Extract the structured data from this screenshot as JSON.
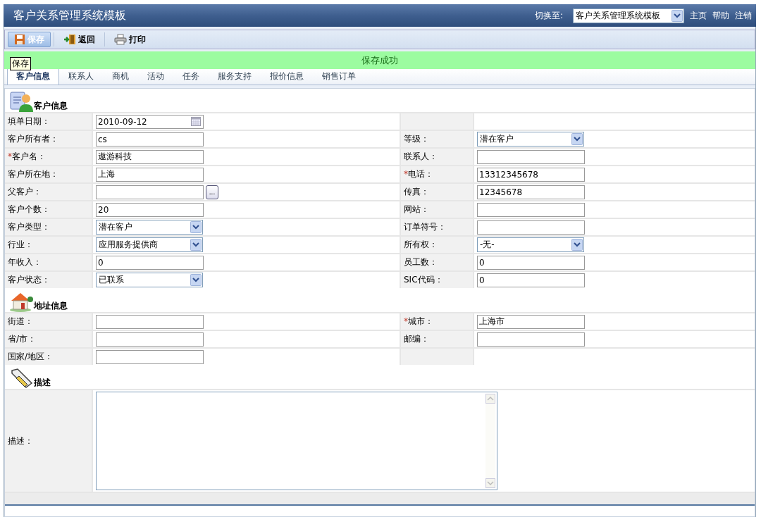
{
  "header": {
    "title": "客户关系管理系统模板",
    "switch_label": "切换至:",
    "switch_value": "客户关系管理系统模板",
    "links": [
      "主页",
      "帮助",
      "注销"
    ]
  },
  "toolbar": [
    {
      "kind": "save",
      "label": "保存",
      "highlighted": true
    },
    {
      "kind": "back",
      "label": "返回",
      "highlighted": false
    },
    {
      "kind": "print",
      "label": "打印",
      "highlighted": false
    }
  ],
  "tooltip": "保存",
  "status_message": "保存成功",
  "tabs": [
    {
      "label": "客户信息",
      "selected": true
    },
    {
      "label": "联系人",
      "selected": false
    },
    {
      "label": "商机",
      "selected": false
    },
    {
      "label": "活动",
      "selected": false
    },
    {
      "label": "任务",
      "selected": false
    },
    {
      "label": "服务支持",
      "selected": false
    },
    {
      "label": "报价信息",
      "selected": false
    },
    {
      "label": "销售订单",
      "selected": false
    }
  ],
  "sections": [
    {
      "kind": "customer",
      "title": "客户信息",
      "rows": [
        {
          "left": {
            "label": "填单日期：",
            "field": {
              "kind": "date",
              "value": "2010-09-12"
            }
          },
          "right": null
        },
        {
          "left": {
            "label": "客户所有者：",
            "field": {
              "kind": "text",
              "value": "cs"
            }
          },
          "right": {
            "label": "等级：",
            "field": {
              "kind": "select",
              "value": "潜在客户"
            }
          }
        },
        {
          "left": {
            "label": "客户名：",
            "mark": "*",
            "field": {
              "kind": "text",
              "value": "遨游科技"
            }
          },
          "right": {
            "label": "联系人：",
            "field": {
              "kind": "text"
            }
          }
        },
        {
          "left": {
            "label": "客户所在地：",
            "field": {
              "kind": "text",
              "value": "上海"
            }
          },
          "right": {
            "label": "电话：",
            "mark": "*",
            "field": {
              "kind": "text",
              "value": "13312345678"
            }
          }
        },
        {
          "left": {
            "label": "父客户：",
            "field": {
              "kind": "lookup",
              "button": "..."
            }
          },
          "right": {
            "label": "传真：",
            "field": {
              "kind": "text",
              "value": "12345678"
            }
          }
        },
        {
          "left": {
            "label": "客户个数：",
            "field": {
              "kind": "text",
              "value": "20"
            }
          },
          "right": {
            "label": "网站：",
            "field": {
              "kind": "text"
            }
          }
        },
        {
          "left": {
            "label": "客户类型：",
            "field": {
              "kind": "select",
              "value": "潜在客户"
            }
          },
          "right": {
            "label": "订单符号：",
            "field": {
              "kind": "text"
            }
          }
        },
        {
          "left": {
            "label": "行业：",
            "field": {
              "kind": "select",
              "value": "应用服务提供商"
            }
          },
          "right": {
            "label": "所有权：",
            "field": {
              "kind": "select",
              "value": "-无-"
            }
          }
        },
        {
          "left": {
            "label": "年收入：",
            "field": {
              "kind": "text",
              "value": "0"
            }
          },
          "right": {
            "label": "员工数：",
            "field": {
              "kind": "text",
              "value": "0"
            }
          }
        },
        {
          "left": {
            "label": "客户状态：",
            "field": {
              "kind": "select",
              "value": "已联系"
            }
          },
          "right": {
            "label": "SIC代码：",
            "field": {
              "kind": "text",
              "value": "0"
            }
          }
        }
      ]
    },
    {
      "kind": "address",
      "title": "地址信息",
      "rows": [
        {
          "left": {
            "label": "街道：",
            "field": {
              "kind": "text"
            }
          },
          "right": {
            "label": "城市：",
            "mark": "*",
            "field": {
              "kind": "text",
              "value": "上海市"
            }
          }
        },
        {
          "left": {
            "label": "省/市：",
            "field": {
              "kind": "text"
            }
          },
          "right": {
            "label": "邮编：",
            "field": {
              "kind": "text"
            }
          }
        },
        {
          "left": {
            "label": "国家/地区：",
            "field": {
              "kind": "text"
            }
          },
          "right": null
        }
      ]
    },
    {
      "kind": "description",
      "title": "描述",
      "rows": [
        {
          "left": {
            "label": "描述：",
            "field": {
              "kind": "textarea"
            }
          },
          "right": null
        }
      ]
    }
  ]
}
